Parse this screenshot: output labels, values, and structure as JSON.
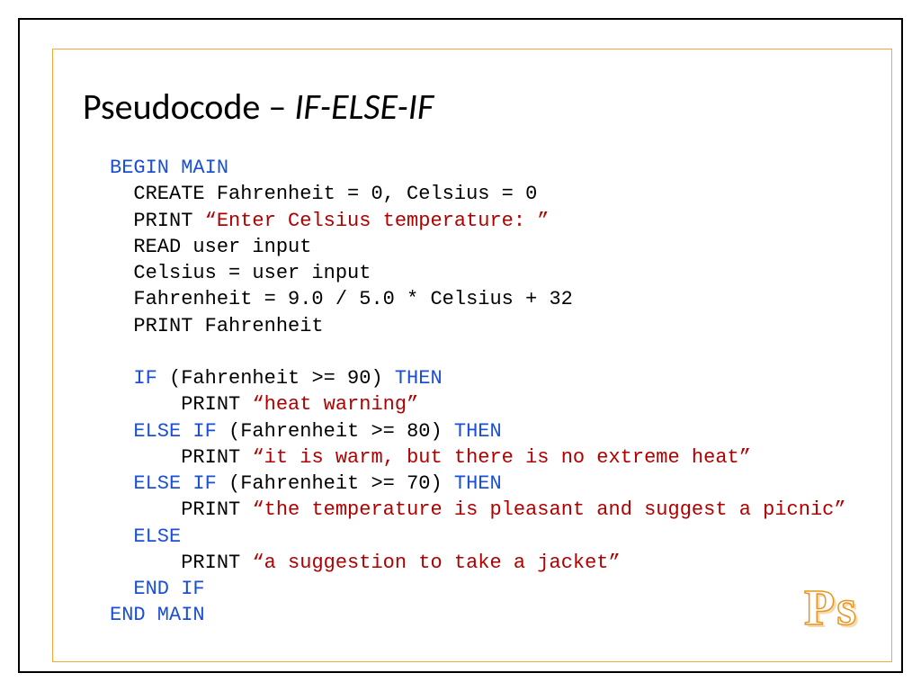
{
  "title": {
    "plain": "Pseudocode – ",
    "italic": "IF-ELSE-IF"
  },
  "logo": "Ps",
  "code": {
    "l01a": "BEGIN MAIN",
    "l02a": "  CREATE Fahrenheit = 0, Celsius = 0",
    "l03a": "  PRINT ",
    "l03b": "“Enter Celsius temperature: ”",
    "l04a": "  READ user input",
    "l05a": "  Celsius = user input",
    "l06a": "  Fahrenheit = 9.0 / 5.0 * Celsius + 32",
    "l07a": "  PRINT Fahrenheit",
    "l09a": "  ",
    "l09b": "IF",
    "l09c": " (Fahrenheit >= 90) ",
    "l09d": "THEN",
    "l10a": "      PRINT ",
    "l10b": "“heat warning”",
    "l11a": "  ",
    "l11b": "ELSE IF",
    "l11c": " (Fahrenheit >= 80) ",
    "l11d": "THEN",
    "l12a": "      PRINT ",
    "l12b": "“it is warm, but there is no extreme heat”",
    "l13a": "  ",
    "l13b": "ELSE IF",
    "l13c": " (Fahrenheit >= 70) ",
    "l13d": "THEN",
    "l14a": "      PRINT ",
    "l14b": "“the temperature is pleasant and suggest a picnic”",
    "l15a": "  ",
    "l15b": "ELSE",
    "l16a": "      PRINT ",
    "l16b": "“a suggestion to take a jacket”",
    "l17a": "  ",
    "l17b": "END IF",
    "l18a": "END MAIN"
  }
}
